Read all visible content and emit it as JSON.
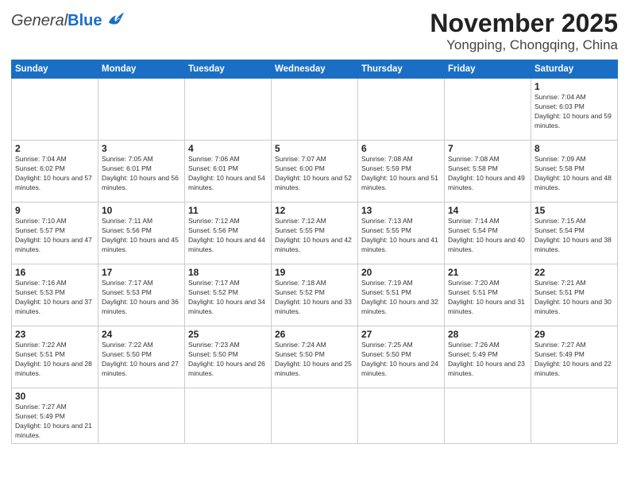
{
  "logo": {
    "general": "General",
    "blue": "Blue"
  },
  "title": "November 2025",
  "subtitle": "Yongping, Chongqing, China",
  "weekdays": [
    "Sunday",
    "Monday",
    "Tuesday",
    "Wednesday",
    "Thursday",
    "Friday",
    "Saturday"
  ],
  "days": [
    {
      "date": null,
      "sunrise": null,
      "sunset": null,
      "daylight": null
    },
    {
      "date": null,
      "sunrise": null,
      "sunset": null,
      "daylight": null
    },
    {
      "date": null,
      "sunrise": null,
      "sunset": null,
      "daylight": null
    },
    {
      "date": null,
      "sunrise": null,
      "sunset": null,
      "daylight": null
    },
    {
      "date": null,
      "sunrise": null,
      "sunset": null,
      "daylight": null
    },
    {
      "date": null,
      "sunrise": null,
      "sunset": null,
      "daylight": null
    },
    {
      "date": "1",
      "sunrise": "7:04 AM",
      "sunset": "6:03 PM",
      "daylight": "10 hours and 59 minutes."
    },
    {
      "date": "2",
      "sunrise": "7:04 AM",
      "sunset": "6:02 PM",
      "daylight": "10 hours and 57 minutes."
    },
    {
      "date": "3",
      "sunrise": "7:05 AM",
      "sunset": "6:01 PM",
      "daylight": "10 hours and 56 minutes."
    },
    {
      "date": "4",
      "sunrise": "7:06 AM",
      "sunset": "6:01 PM",
      "daylight": "10 hours and 54 minutes."
    },
    {
      "date": "5",
      "sunrise": "7:07 AM",
      "sunset": "6:00 PM",
      "daylight": "10 hours and 52 minutes."
    },
    {
      "date": "6",
      "sunrise": "7:08 AM",
      "sunset": "5:59 PM",
      "daylight": "10 hours and 51 minutes."
    },
    {
      "date": "7",
      "sunrise": "7:08 AM",
      "sunset": "5:58 PM",
      "daylight": "10 hours and 49 minutes."
    },
    {
      "date": "8",
      "sunrise": "7:09 AM",
      "sunset": "5:58 PM",
      "daylight": "10 hours and 48 minutes."
    },
    {
      "date": "9",
      "sunrise": "7:10 AM",
      "sunset": "5:57 PM",
      "daylight": "10 hours and 47 minutes."
    },
    {
      "date": "10",
      "sunrise": "7:11 AM",
      "sunset": "5:56 PM",
      "daylight": "10 hours and 45 minutes."
    },
    {
      "date": "11",
      "sunrise": "7:12 AM",
      "sunset": "5:56 PM",
      "daylight": "10 hours and 44 minutes."
    },
    {
      "date": "12",
      "sunrise": "7:12 AM",
      "sunset": "5:55 PM",
      "daylight": "10 hours and 42 minutes."
    },
    {
      "date": "13",
      "sunrise": "7:13 AM",
      "sunset": "5:55 PM",
      "daylight": "10 hours and 41 minutes."
    },
    {
      "date": "14",
      "sunrise": "7:14 AM",
      "sunset": "5:54 PM",
      "daylight": "10 hours and 40 minutes."
    },
    {
      "date": "15",
      "sunrise": "7:15 AM",
      "sunset": "5:54 PM",
      "daylight": "10 hours and 38 minutes."
    },
    {
      "date": "16",
      "sunrise": "7:16 AM",
      "sunset": "5:53 PM",
      "daylight": "10 hours and 37 minutes."
    },
    {
      "date": "17",
      "sunrise": "7:17 AM",
      "sunset": "5:53 PM",
      "daylight": "10 hours and 36 minutes."
    },
    {
      "date": "18",
      "sunrise": "7:17 AM",
      "sunset": "5:52 PM",
      "daylight": "10 hours and 34 minutes."
    },
    {
      "date": "19",
      "sunrise": "7:18 AM",
      "sunset": "5:52 PM",
      "daylight": "10 hours and 33 minutes."
    },
    {
      "date": "20",
      "sunrise": "7:19 AM",
      "sunset": "5:51 PM",
      "daylight": "10 hours and 32 minutes."
    },
    {
      "date": "21",
      "sunrise": "7:20 AM",
      "sunset": "5:51 PM",
      "daylight": "10 hours and 31 minutes."
    },
    {
      "date": "22",
      "sunrise": "7:21 AM",
      "sunset": "5:51 PM",
      "daylight": "10 hours and 30 minutes."
    },
    {
      "date": "23",
      "sunrise": "7:22 AM",
      "sunset": "5:51 PM",
      "daylight": "10 hours and 28 minutes."
    },
    {
      "date": "24",
      "sunrise": "7:22 AM",
      "sunset": "5:50 PM",
      "daylight": "10 hours and 27 minutes."
    },
    {
      "date": "25",
      "sunrise": "7:23 AM",
      "sunset": "5:50 PM",
      "daylight": "10 hours and 26 minutes."
    },
    {
      "date": "26",
      "sunrise": "7:24 AM",
      "sunset": "5:50 PM",
      "daylight": "10 hours and 25 minutes."
    },
    {
      "date": "27",
      "sunrise": "7:25 AM",
      "sunset": "5:50 PM",
      "daylight": "10 hours and 24 minutes."
    },
    {
      "date": "28",
      "sunrise": "7:26 AM",
      "sunset": "5:49 PM",
      "daylight": "10 hours and 23 minutes."
    },
    {
      "date": "29",
      "sunrise": "7:27 AM",
      "sunset": "5:49 PM",
      "daylight": "10 hours and 22 minutes."
    },
    {
      "date": "30",
      "sunrise": "7:27 AM",
      "sunset": "5:49 PM",
      "daylight": "10 hours and 21 minutes."
    }
  ]
}
